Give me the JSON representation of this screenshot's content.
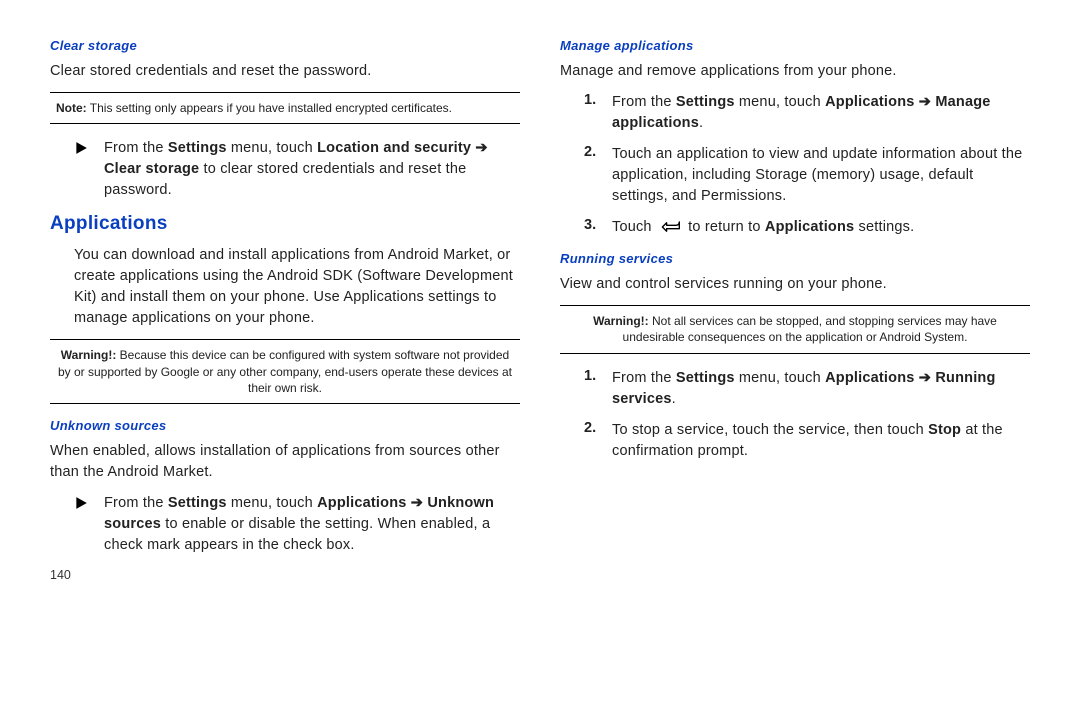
{
  "page_number": "140",
  "left": {
    "clear_storage": {
      "heading": "Clear storage",
      "intro": "Clear stored credentials and reset the password.",
      "note_prefix": "Note:",
      "note": " This setting only appears if you have installed encrypted certificates.",
      "bullet_pre": "From the ",
      "bullet_b1": "Settings",
      "bullet_mid1": " menu, touch ",
      "bullet_b2": "Location and security ",
      "bullet_arrow": "➔",
      "bullet_b3": " Clear storage",
      "bullet_post": " to clear stored credentials and reset the password."
    },
    "applications": {
      "heading": "Applications",
      "intro": "You can download and install applications from Android Market, or create applications using the Android SDK (Software Development Kit) and install them on your phone. Use Applications settings to manage applications on your phone.",
      "warn_prefix": "Warning!:",
      "warn": " Because this device can be configured with system software not provided by or supported by Google or any other company, end-users operate these devices at their own risk."
    },
    "unknown": {
      "heading": "Unknown sources",
      "intro": "When enabled, allows installation of applications from sources other than the Android Market.",
      "bullet_pre": "From the ",
      "bullet_b1": "Settings",
      "bullet_mid1": " menu, touch ",
      "bullet_b2": "Applications ",
      "bullet_arrow": "➔",
      "bullet_b3": " Unknown sources",
      "bullet_post": " to enable or disable the setting. When enabled, a check mark appears in the check box."
    }
  },
  "right": {
    "manage": {
      "heading": "Manage applications",
      "intro": "Manage and remove applications from your phone.",
      "step1_pre": "From the ",
      "step1_b1": "Settings",
      "step1_mid": " menu, touch ",
      "step1_b2": "Applications ",
      "step1_arrow": "➔",
      "step1_b3": " Manage applications",
      "step1_post": ".",
      "step2": "Touch an application to view and update information about the application, including Storage (memory) usage, default settings, and Permissions.",
      "step3_pre": "Touch ",
      "step3_mid": " to return to ",
      "step3_b": "Applications",
      "step3_post": " settings."
    },
    "running": {
      "heading": "Running services",
      "intro": "View and control services running on your phone.",
      "warn_prefix": "Warning!:",
      "warn": " Not all services can be stopped, and stopping services may have undesirable consequences on the application or Android System.",
      "step1_pre": "From the ",
      "step1_b1": "Settings",
      "step1_mid": " menu, touch ",
      "step1_b2": "Applications ",
      "step1_arrow": "➔",
      "step1_b3": " Running services",
      "step1_post": ".",
      "step2_pre": "To stop a service, touch the service, then touch ",
      "step2_b": "Stop",
      "step2_post": " at the confirmation prompt."
    }
  }
}
